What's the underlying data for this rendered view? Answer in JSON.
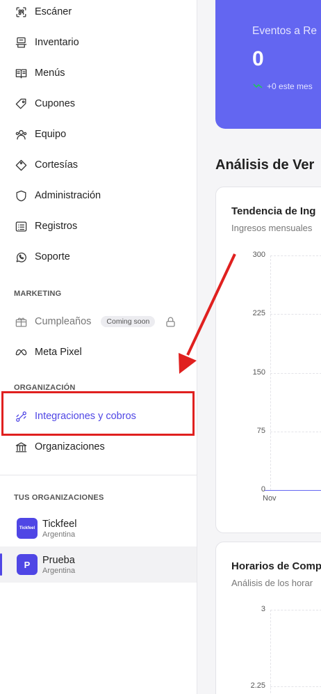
{
  "sidebar": {
    "items": [
      {
        "label": "Escáner",
        "icon": "scanner-icon"
      },
      {
        "label": "Inventario",
        "icon": "inventory-icon"
      },
      {
        "label": "Menús",
        "icon": "book-icon"
      },
      {
        "label": "Cupones",
        "icon": "ticket-icon"
      },
      {
        "label": "Equipo",
        "icon": "users-icon"
      },
      {
        "label": "Cortesías",
        "icon": "tag-icon"
      },
      {
        "label": "Administración",
        "icon": "shield-icon"
      },
      {
        "label": "Registros",
        "icon": "list-icon"
      },
      {
        "label": "Soporte",
        "icon": "whatsapp-icon"
      }
    ],
    "marketing_label": "MARKETING",
    "birthdays": {
      "label": "Cumpleaños",
      "badge": "Coming soon"
    },
    "meta_pixel": {
      "label": "Meta Pixel"
    },
    "org_label": "ORGANIZACIÓN",
    "integrations": {
      "label": "Integraciones y cobros"
    },
    "organizations": {
      "label": "Organizaciones"
    },
    "your_orgs_label": "TUS ORGANIZACIONES",
    "orgs": [
      {
        "name": "Tickfeel",
        "country": "Argentina",
        "avatar_text": "Tickfeel",
        "color": "#4f46e5"
      },
      {
        "name": "Prueba",
        "country": "Argentina",
        "avatar_text": "P",
        "color": "#4f46e5"
      }
    ]
  },
  "main": {
    "stat": {
      "title": "Eventos a Re",
      "value": "0",
      "change": "+0 este mes",
      "color": "#6366f1"
    },
    "section_title": "Análisis de Ver",
    "chart1": {
      "title": "Tendencia de Ing",
      "subtitle": "Ingresos mensuales"
    },
    "chart2": {
      "title": "Horarios de Comp",
      "subtitle": "Análisis de los horar"
    }
  },
  "chart_data": [
    {
      "type": "line",
      "title": "Tendencia de Ing",
      "subtitle": "Ingresos mensuales",
      "x": [
        "Nov"
      ],
      "yticks": [
        "300",
        "225",
        "150",
        "75",
        "0"
      ],
      "ylim": [
        0,
        300
      ],
      "series": [
        {
          "values": [
            0
          ]
        }
      ]
    },
    {
      "type": "line",
      "title": "Horarios de Comp",
      "subtitle": "Análisis de los horar",
      "yticks": [
        "3",
        "2.25"
      ],
      "ylim": [
        0,
        3
      ]
    }
  ]
}
